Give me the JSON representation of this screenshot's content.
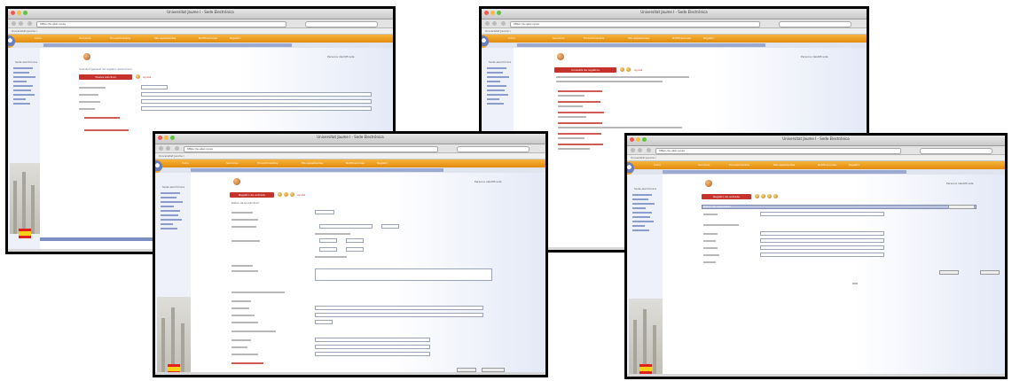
{
  "screenshots": [
    {
      "window_title": "Universitat Jaume I - Sede Electrónica",
      "url": "https://e-ujier.uji.es",
      "bookmark": "Universitat Jaume I",
      "menu": [
        "Inicio",
        "Servicios",
        "Procedimientos",
        "Mis expedientes",
        "Notificaciones",
        "Registro"
      ],
      "side_title": "Sede electrónica",
      "side_links": 9,
      "content_title": "Solicitud general de registro electrónico",
      "button_label": "Nueva solicitud",
      "link_label": "Ayuda",
      "info": "Persona identificada"
    },
    {
      "window_title": "Universitat Jaume I - Sede Electrónica",
      "url": "https://e-ujier.uji.es",
      "bookmark": "Universitat Jaume I",
      "menu": [
        "Inicio",
        "Servicios",
        "Procedimientos",
        "Mis expedientes",
        "Notificaciones",
        "Registro"
      ],
      "side_title": "Sede electrónica",
      "side_links": 9,
      "content_title": "Registro electrónico",
      "button_label": "Consulta de registros",
      "link_label": "Ayuda",
      "info": "Persona identificada"
    },
    {
      "window_title": "Universitat Jaume I - Sede Electrónica",
      "url": "https://e-ujier.uji.es",
      "bookmark": "Universitat Jaume I",
      "menu": [
        "Inicio",
        "Servicios",
        "Procedimientos",
        "Mis expedientes",
        "Notificaciones",
        "Registro"
      ],
      "side_title": "Sede electrónica",
      "side_links": 9,
      "content_title": "Datos de la solicitud",
      "button_label": "Registro de entrada",
      "link_label": "Ayuda",
      "info": "Persona identificada"
    },
    {
      "window_title": "Universitat Jaume I - Sede Electrónica",
      "url": "https://e-ujier.uji.es",
      "bookmark": "Universitat Jaume I",
      "menu": [
        "Inicio",
        "Servicios",
        "Procedimientos",
        "Mis expedientes",
        "Notificaciones",
        "Registro"
      ],
      "side_title": "Sede electrónica",
      "side_links": 9,
      "content_title": "Datos del interesado",
      "button_label": "Registro de entrada",
      "link_label": "",
      "info": "Persona identificada"
    }
  ]
}
